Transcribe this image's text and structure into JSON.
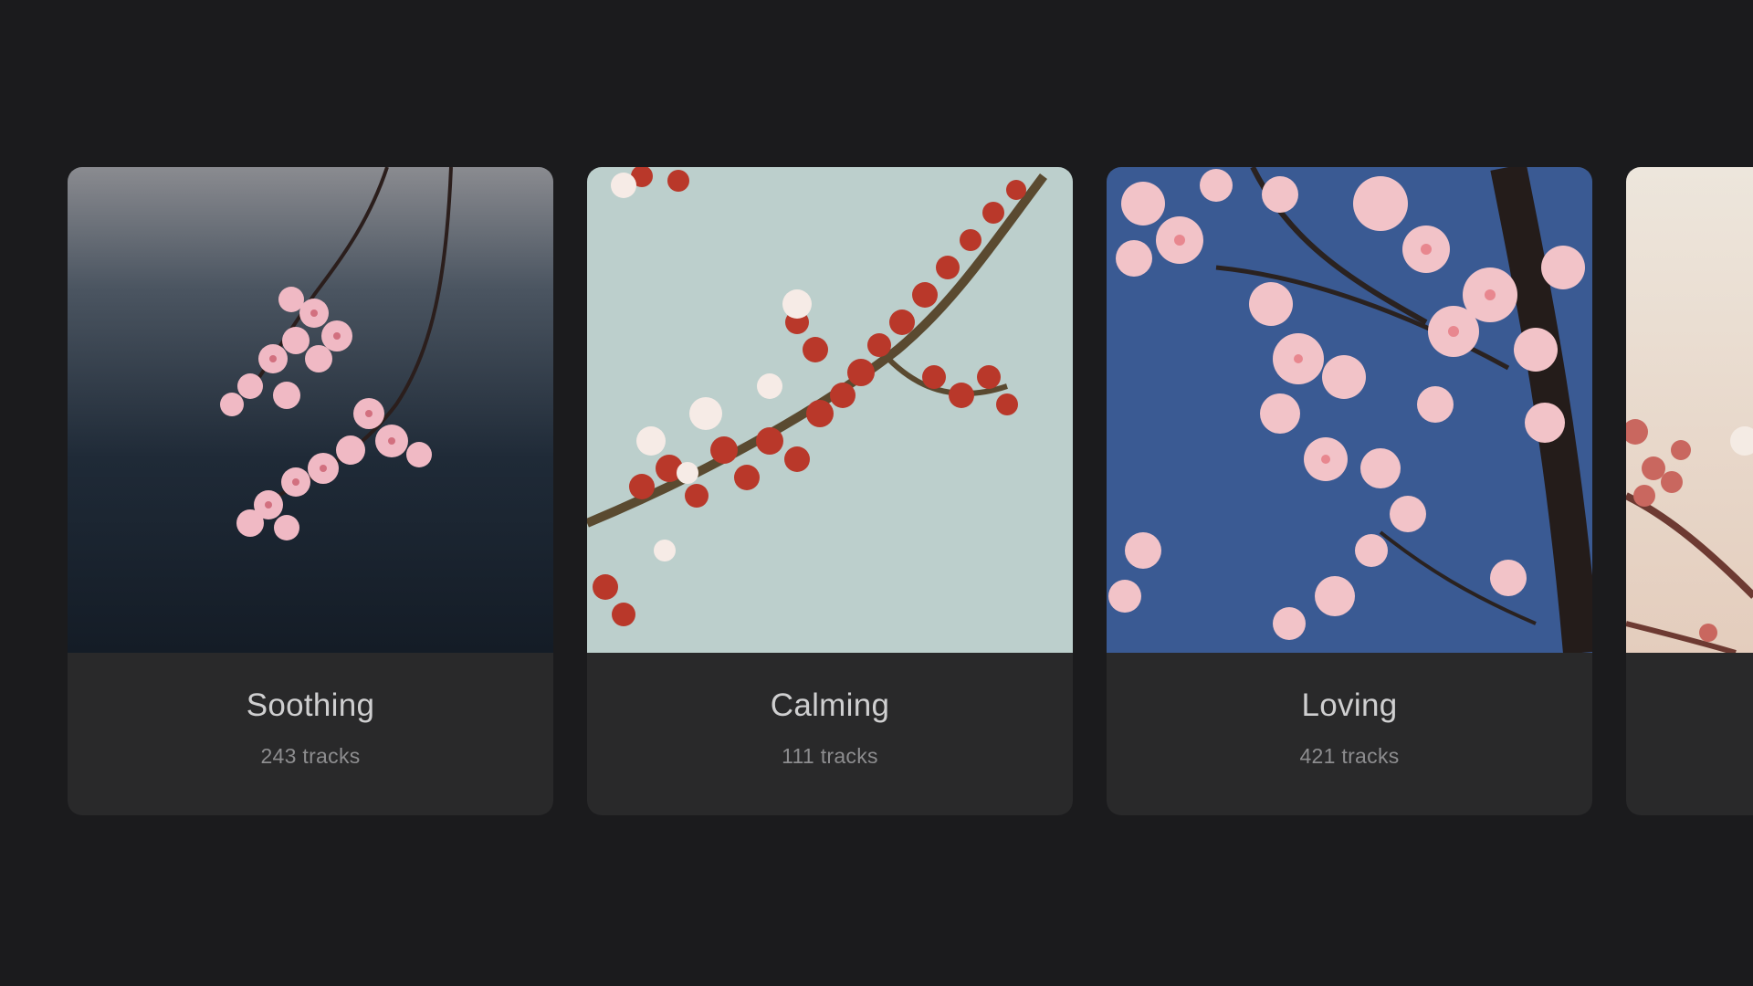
{
  "playlists": [
    {
      "title": "Soothing",
      "tracks": "243 tracks",
      "image_icon": "cherry-blossom-branch-dark-sky",
      "colors": {
        "sky_top": "#7d7f86",
        "sky_bottom": "#17212c",
        "blossom": "#f0b9c4",
        "branch": "#2b1e1c"
      }
    },
    {
      "title": "Calming",
      "tracks": "111 tracks",
      "image_icon": "cherry-blossom-buds-pale-sky",
      "colors": {
        "sky_top": "#b5cac8",
        "sky_bottom": "#c5d3d0",
        "blossom": "#f4e4de",
        "bud": "#b9382a",
        "branch": "#5a4a30"
      }
    },
    {
      "title": "Loving",
      "tracks": "421 tracks",
      "image_icon": "cherry-blossom-tree-blue-sky",
      "colors": {
        "sky_top": "#3f5f98",
        "sky_bottom": "#35568f",
        "blossom": "#f2c3c8",
        "branch": "#2a2220"
      }
    },
    {
      "title": "",
      "tracks": "",
      "image_icon": "cherry-blossom-warm-light",
      "colors": {
        "sky_top": "#efe3d8",
        "sky_bottom": "#e6d2c2",
        "blossom": "#e9b0ae",
        "branch": "#6d3a32"
      }
    }
  ],
  "background_color": "#1b1b1d",
  "card_color": "#29292a"
}
